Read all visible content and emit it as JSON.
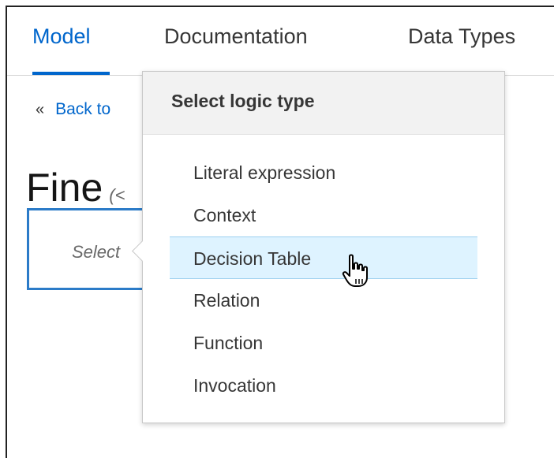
{
  "tabs": [
    {
      "label": "Model",
      "active": true
    },
    {
      "label": "Documentation",
      "active": false
    },
    {
      "label": "Data Types",
      "active": false
    }
  ],
  "back_link": {
    "icon": "double-chevron-left-icon",
    "chevron": "«",
    "label": "Back to"
  },
  "decision": {
    "title": "Fine",
    "type_hint": "(<",
    "expression_placeholder": "Select"
  },
  "logic_popover": {
    "title": "Select logic type",
    "items": [
      {
        "label": "Literal expression",
        "hovered": false
      },
      {
        "label": "Context",
        "hovered": false
      },
      {
        "label": "Decision Table",
        "hovered": true
      },
      {
        "label": "Relation",
        "hovered": false
      },
      {
        "label": "Function",
        "hovered": false
      },
      {
        "label": "Invocation",
        "hovered": false
      }
    ]
  },
  "colors": {
    "accent": "#0066cc",
    "hover_background": "#def3ff",
    "hover_border": "#9cd0ef",
    "selection_border": "#2b7bc8"
  }
}
